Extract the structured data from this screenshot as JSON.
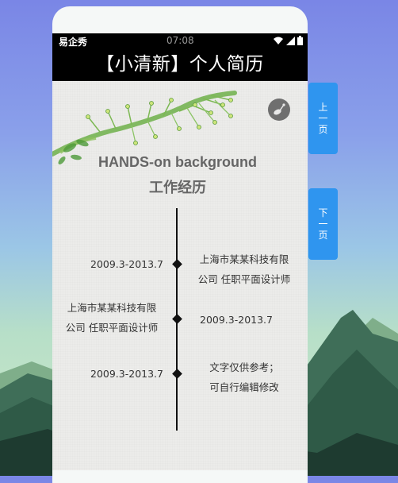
{
  "status_bar": {
    "carrier": "易企秀",
    "time": "07:08"
  },
  "title": "【小清新】个人简历",
  "heading_en": "HANDS-on background",
  "heading_zh": "工作经历",
  "timeline": [
    {
      "left": "2009.3-2013.7",
      "right_line1": "上海市某某科技有限",
      "right_line2": "公司 任职平面设计师"
    },
    {
      "left_line1": "上海市某某科技有限",
      "left_line2": "公司 任职平面设计师",
      "right": "2009.3-2013.7"
    },
    {
      "left": "2009.3-2013.7",
      "right_line1": "文字仅供参考；",
      "right_line2": "可自行编辑修改"
    }
  ],
  "nav": {
    "prev_label": [
      "上",
      "一",
      "页"
    ],
    "next_label": [
      "下",
      "一",
      "页"
    ]
  },
  "colors": {
    "accent": "#2f95ef",
    "bar": "#000000",
    "paper": "#ececea",
    "leaf": "#6fb04a"
  },
  "icons": {
    "music": "music-disc-icon",
    "wifi": "wifi-icon",
    "signal": "signal-icon",
    "battery": "battery-icon"
  }
}
